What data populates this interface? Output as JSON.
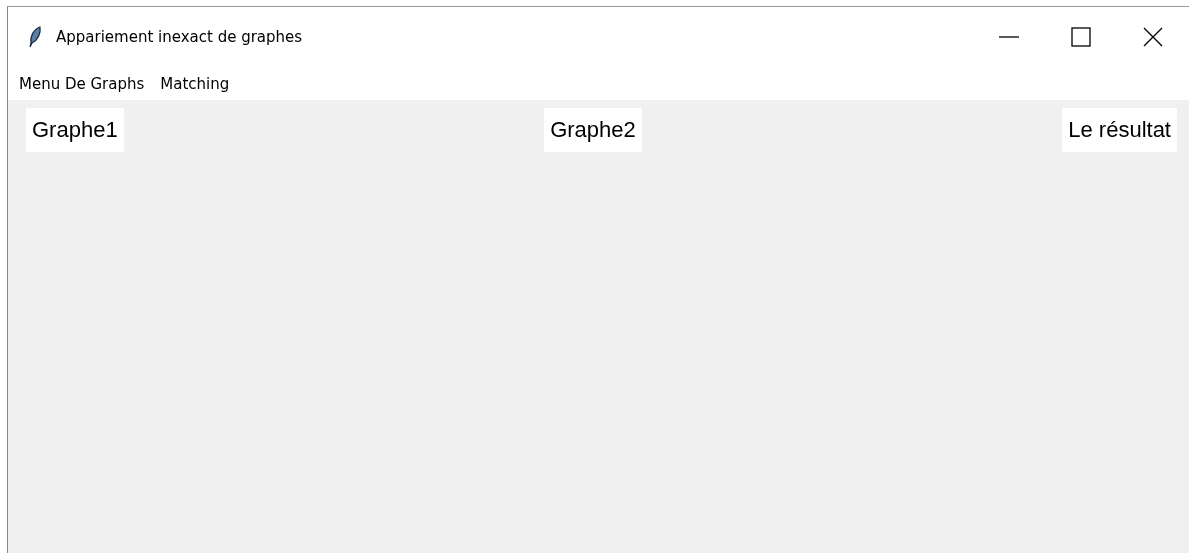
{
  "window": {
    "title": "Appariement inexact de graphes"
  },
  "menu": [
    "Menu De Graphs",
    "Matching"
  ],
  "labels": [
    "Graphe1",
    "Graphe2",
    "Le résultat"
  ]
}
